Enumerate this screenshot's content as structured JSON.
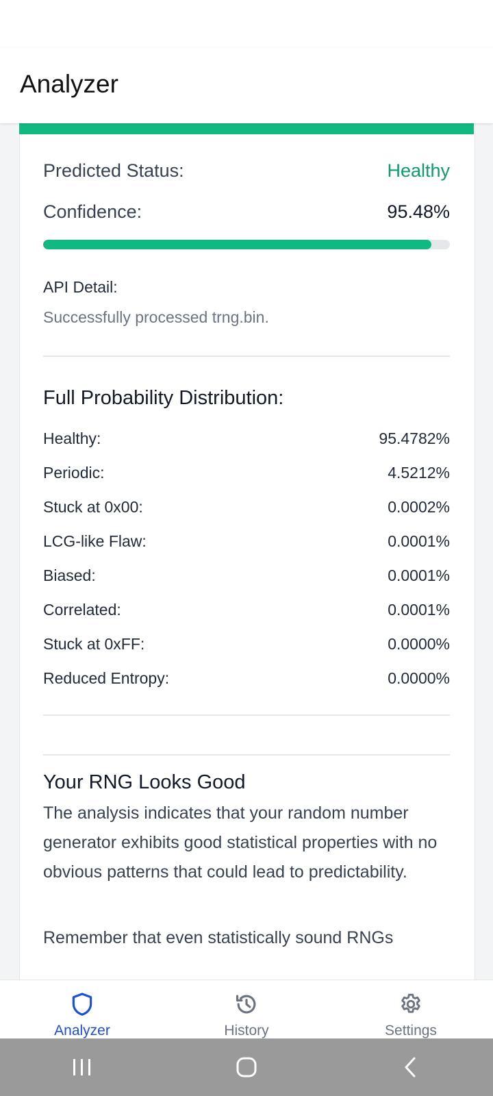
{
  "app_bar": {
    "title": "Analyzer"
  },
  "result": {
    "status_label": "Predicted Status:",
    "status_value": "Healthy",
    "confidence_label": "Confidence:",
    "confidence_value": "95.48%",
    "confidence_fraction": 0.9548,
    "api_label": "API Detail:",
    "api_detail": "Successfully processed trng.bin."
  },
  "distribution": {
    "title": "Full Probability Distribution:",
    "items": [
      {
        "label": "Healthy:",
        "value": "95.4782%"
      },
      {
        "label": "Periodic:",
        "value": "4.5212%"
      },
      {
        "label": "Stuck at 0x00:",
        "value": "0.0002%"
      },
      {
        "label": "LCG-like Flaw:",
        "value": "0.0001%"
      },
      {
        "label": "Biased:",
        "value": "0.0001%"
      },
      {
        "label": "Correlated:",
        "value": "0.0001%"
      },
      {
        "label": "Stuck at 0xFF:",
        "value": "0.0000%"
      },
      {
        "label": "Reduced Entropy:",
        "value": "0.0000%"
      }
    ]
  },
  "advice": {
    "title": "Your RNG Looks Good",
    "paragraph1": "The analysis indicates that your random number generator exhibits good statistical properties with no obvious patterns that could lead to predictability.",
    "paragraph2": "Remember that even statistically sound RNGs"
  },
  "bottom_nav": {
    "items": [
      {
        "label": "Analyzer",
        "icon": "shield-icon",
        "active": true
      },
      {
        "label": "History",
        "icon": "history-icon",
        "active": false
      },
      {
        "label": "Settings",
        "icon": "gear-icon",
        "active": false
      }
    ]
  },
  "system_nav": {
    "icons": [
      "recent-apps-icon",
      "home-icon",
      "back-icon"
    ]
  },
  "colors": {
    "accent": "#10b981",
    "healthy_text": "#0f9b6e",
    "nav_active": "#1d4ed8",
    "nav_inactive": "#6b7280"
  }
}
